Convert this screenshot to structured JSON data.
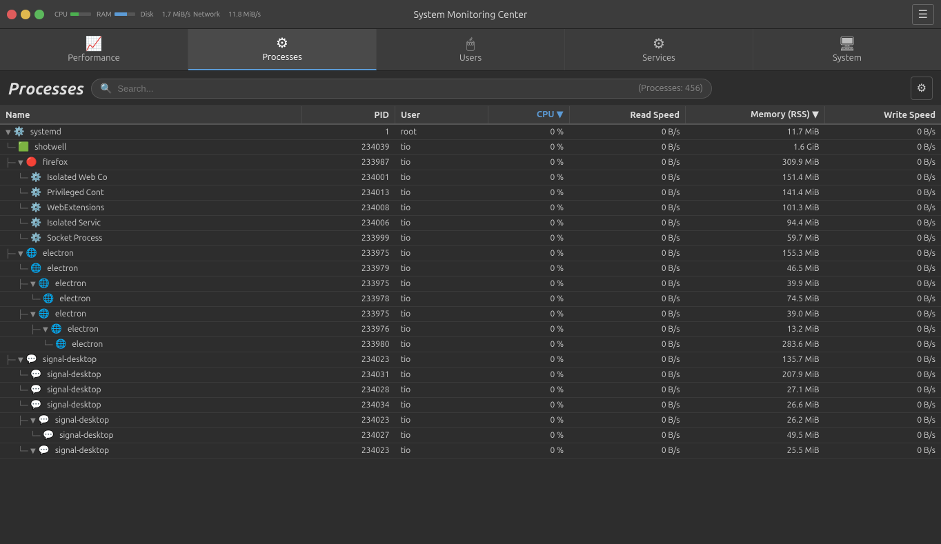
{
  "titlebar": {
    "title": "System Monitoring Center",
    "cpu_label": "CPU",
    "ram_label": "RAM",
    "disk_label": "Disk",
    "network_label": "Network",
    "disk_speed": "1.7 MiB/s",
    "net_speed": "11.8 MiB/s"
  },
  "tabs": [
    {
      "id": "performance",
      "label": "Performance",
      "icon": "📈",
      "active": false
    },
    {
      "id": "processes",
      "label": "Processes",
      "icon": "⚙️",
      "active": true
    },
    {
      "id": "users",
      "label": "Users",
      "icon": "🖱️",
      "active": false
    },
    {
      "id": "services",
      "label": "Services",
      "icon": "⚙",
      "active": false
    },
    {
      "id": "system",
      "label": "System",
      "icon": "🖥️",
      "active": false
    }
  ],
  "page": {
    "title": "Processes",
    "search_placeholder": "Search...",
    "process_count": "(Processes: 456)"
  },
  "columns": [
    {
      "id": "name",
      "label": "Name"
    },
    {
      "id": "pid",
      "label": "PID"
    },
    {
      "id": "user",
      "label": "User"
    },
    {
      "id": "cpu",
      "label": "CPU",
      "sorted": true
    },
    {
      "id": "read",
      "label": "Read Speed"
    },
    {
      "id": "mem",
      "label": "Memory (RSS)"
    },
    {
      "id": "write",
      "label": "Write Speed"
    }
  ],
  "processes": [
    {
      "indent": 0,
      "expand": true,
      "icon": "⚙️",
      "name": "systemd",
      "pid": "1",
      "user": "root",
      "cpu": "0 %",
      "read": "0 B/s",
      "mem": "11.7 MiB",
      "write": "0 B/s"
    },
    {
      "indent": 1,
      "expand": false,
      "icon": "🟩",
      "name": "shotwell",
      "pid": "234039",
      "user": "tio",
      "cpu": "0 %",
      "read": "0 B/s",
      "mem": "1.6 GiB",
      "write": "0 B/s"
    },
    {
      "indent": 1,
      "expand": true,
      "icon": "🔴",
      "name": "firefox",
      "pid": "233987",
      "user": "tio",
      "cpu": "0 %",
      "read": "0 B/s",
      "mem": "309.9 MiB",
      "write": "0 B/s"
    },
    {
      "indent": 2,
      "expand": false,
      "icon": "⚙️",
      "name": "Isolated Web Co",
      "pid": "234001",
      "user": "tio",
      "cpu": "0 %",
      "read": "0 B/s",
      "mem": "151.4 MiB",
      "write": "0 B/s"
    },
    {
      "indent": 2,
      "expand": false,
      "icon": "⚙️",
      "name": "Privileged Cont",
      "pid": "234013",
      "user": "tio",
      "cpu": "0 %",
      "read": "0 B/s",
      "mem": "141.4 MiB",
      "write": "0 B/s"
    },
    {
      "indent": 2,
      "expand": false,
      "icon": "⚙️",
      "name": "WebExtensions",
      "pid": "234008",
      "user": "tio",
      "cpu": "0 %",
      "read": "0 B/s",
      "mem": "101.3 MiB",
      "write": "0 B/s"
    },
    {
      "indent": 2,
      "expand": false,
      "icon": "⚙️",
      "name": "Isolated Servic",
      "pid": "234006",
      "user": "tio",
      "cpu": "0 %",
      "read": "0 B/s",
      "mem": "94.4 MiB",
      "write": "0 B/s"
    },
    {
      "indent": 2,
      "expand": false,
      "icon": "⚙️",
      "name": "Socket Process",
      "pid": "233999",
      "user": "tio",
      "cpu": "0 %",
      "read": "0 B/s",
      "mem": "59.7 MiB",
      "write": "0 B/s"
    },
    {
      "indent": 1,
      "expand": true,
      "icon": "🌐",
      "name": "electron",
      "pid": "233975",
      "user": "tio",
      "cpu": "0 %",
      "read": "0 B/s",
      "mem": "155.3 MiB",
      "write": "0 B/s"
    },
    {
      "indent": 2,
      "expand": false,
      "icon": "🌐",
      "name": "electron",
      "pid": "233979",
      "user": "tio",
      "cpu": "0 %",
      "read": "0 B/s",
      "mem": "46.5 MiB",
      "write": "0 B/s"
    },
    {
      "indent": 2,
      "expand": true,
      "icon": "🌐",
      "name": "electron",
      "pid": "233975",
      "user": "tio",
      "cpu": "0 %",
      "read": "0 B/s",
      "mem": "39.9 MiB",
      "write": "0 B/s"
    },
    {
      "indent": 3,
      "expand": false,
      "icon": "🌐",
      "name": "electron",
      "pid": "233978",
      "user": "tio",
      "cpu": "0 %",
      "read": "0 B/s",
      "mem": "74.5 MiB",
      "write": "0 B/s"
    },
    {
      "indent": 2,
      "expand": true,
      "icon": "🌐",
      "name": "electron",
      "pid": "233975",
      "user": "tio",
      "cpu": "0 %",
      "read": "0 B/s",
      "mem": "39.0 MiB",
      "write": "0 B/s"
    },
    {
      "indent": 3,
      "expand": true,
      "icon": "🌐",
      "name": "electron",
      "pid": "233976",
      "user": "tio",
      "cpu": "0 %",
      "read": "0 B/s",
      "mem": "13.2 MiB",
      "write": "0 B/s"
    },
    {
      "indent": 4,
      "expand": false,
      "icon": "🌐",
      "name": "electron",
      "pid": "233980",
      "user": "tio",
      "cpu": "0 %",
      "read": "0 B/s",
      "mem": "283.6 MiB",
      "write": "0 B/s"
    },
    {
      "indent": 1,
      "expand": true,
      "icon": "💬",
      "name": "signal-desktop",
      "pid": "234023",
      "user": "tio",
      "cpu": "0 %",
      "read": "0 B/s",
      "mem": "135.7 MiB",
      "write": "0 B/s"
    },
    {
      "indent": 2,
      "expand": false,
      "icon": "💬",
      "name": "signal-desktop",
      "pid": "234031",
      "user": "tio",
      "cpu": "0 %",
      "read": "0 B/s",
      "mem": "207.9 MiB",
      "write": "0 B/s"
    },
    {
      "indent": 2,
      "expand": false,
      "icon": "💬",
      "name": "signal-desktop",
      "pid": "234028",
      "user": "tio",
      "cpu": "0 %",
      "read": "0 B/s",
      "mem": "27.1 MiB",
      "write": "0 B/s"
    },
    {
      "indent": 2,
      "expand": false,
      "icon": "💬",
      "name": "signal-desktop",
      "pid": "234034",
      "user": "tio",
      "cpu": "0 %",
      "read": "0 B/s",
      "mem": "26.6 MiB",
      "write": "0 B/s"
    },
    {
      "indent": 2,
      "expand": true,
      "icon": "💬",
      "name": "signal-desktop",
      "pid": "234023",
      "user": "tio",
      "cpu": "0 %",
      "read": "0 B/s",
      "mem": "26.2 MiB",
      "write": "0 B/s"
    },
    {
      "indent": 3,
      "expand": false,
      "icon": "💬",
      "name": "signal-desktop",
      "pid": "234027",
      "user": "tio",
      "cpu": "0 %",
      "read": "0 B/s",
      "mem": "49.5 MiB",
      "write": "0 B/s"
    },
    {
      "indent": 2,
      "expand": true,
      "icon": "💬",
      "name": "signal-desktop",
      "pid": "234023",
      "user": "tio",
      "cpu": "0 %",
      "read": "0 B/s",
      "mem": "25.5 MiB",
      "write": "0 B/s"
    }
  ]
}
